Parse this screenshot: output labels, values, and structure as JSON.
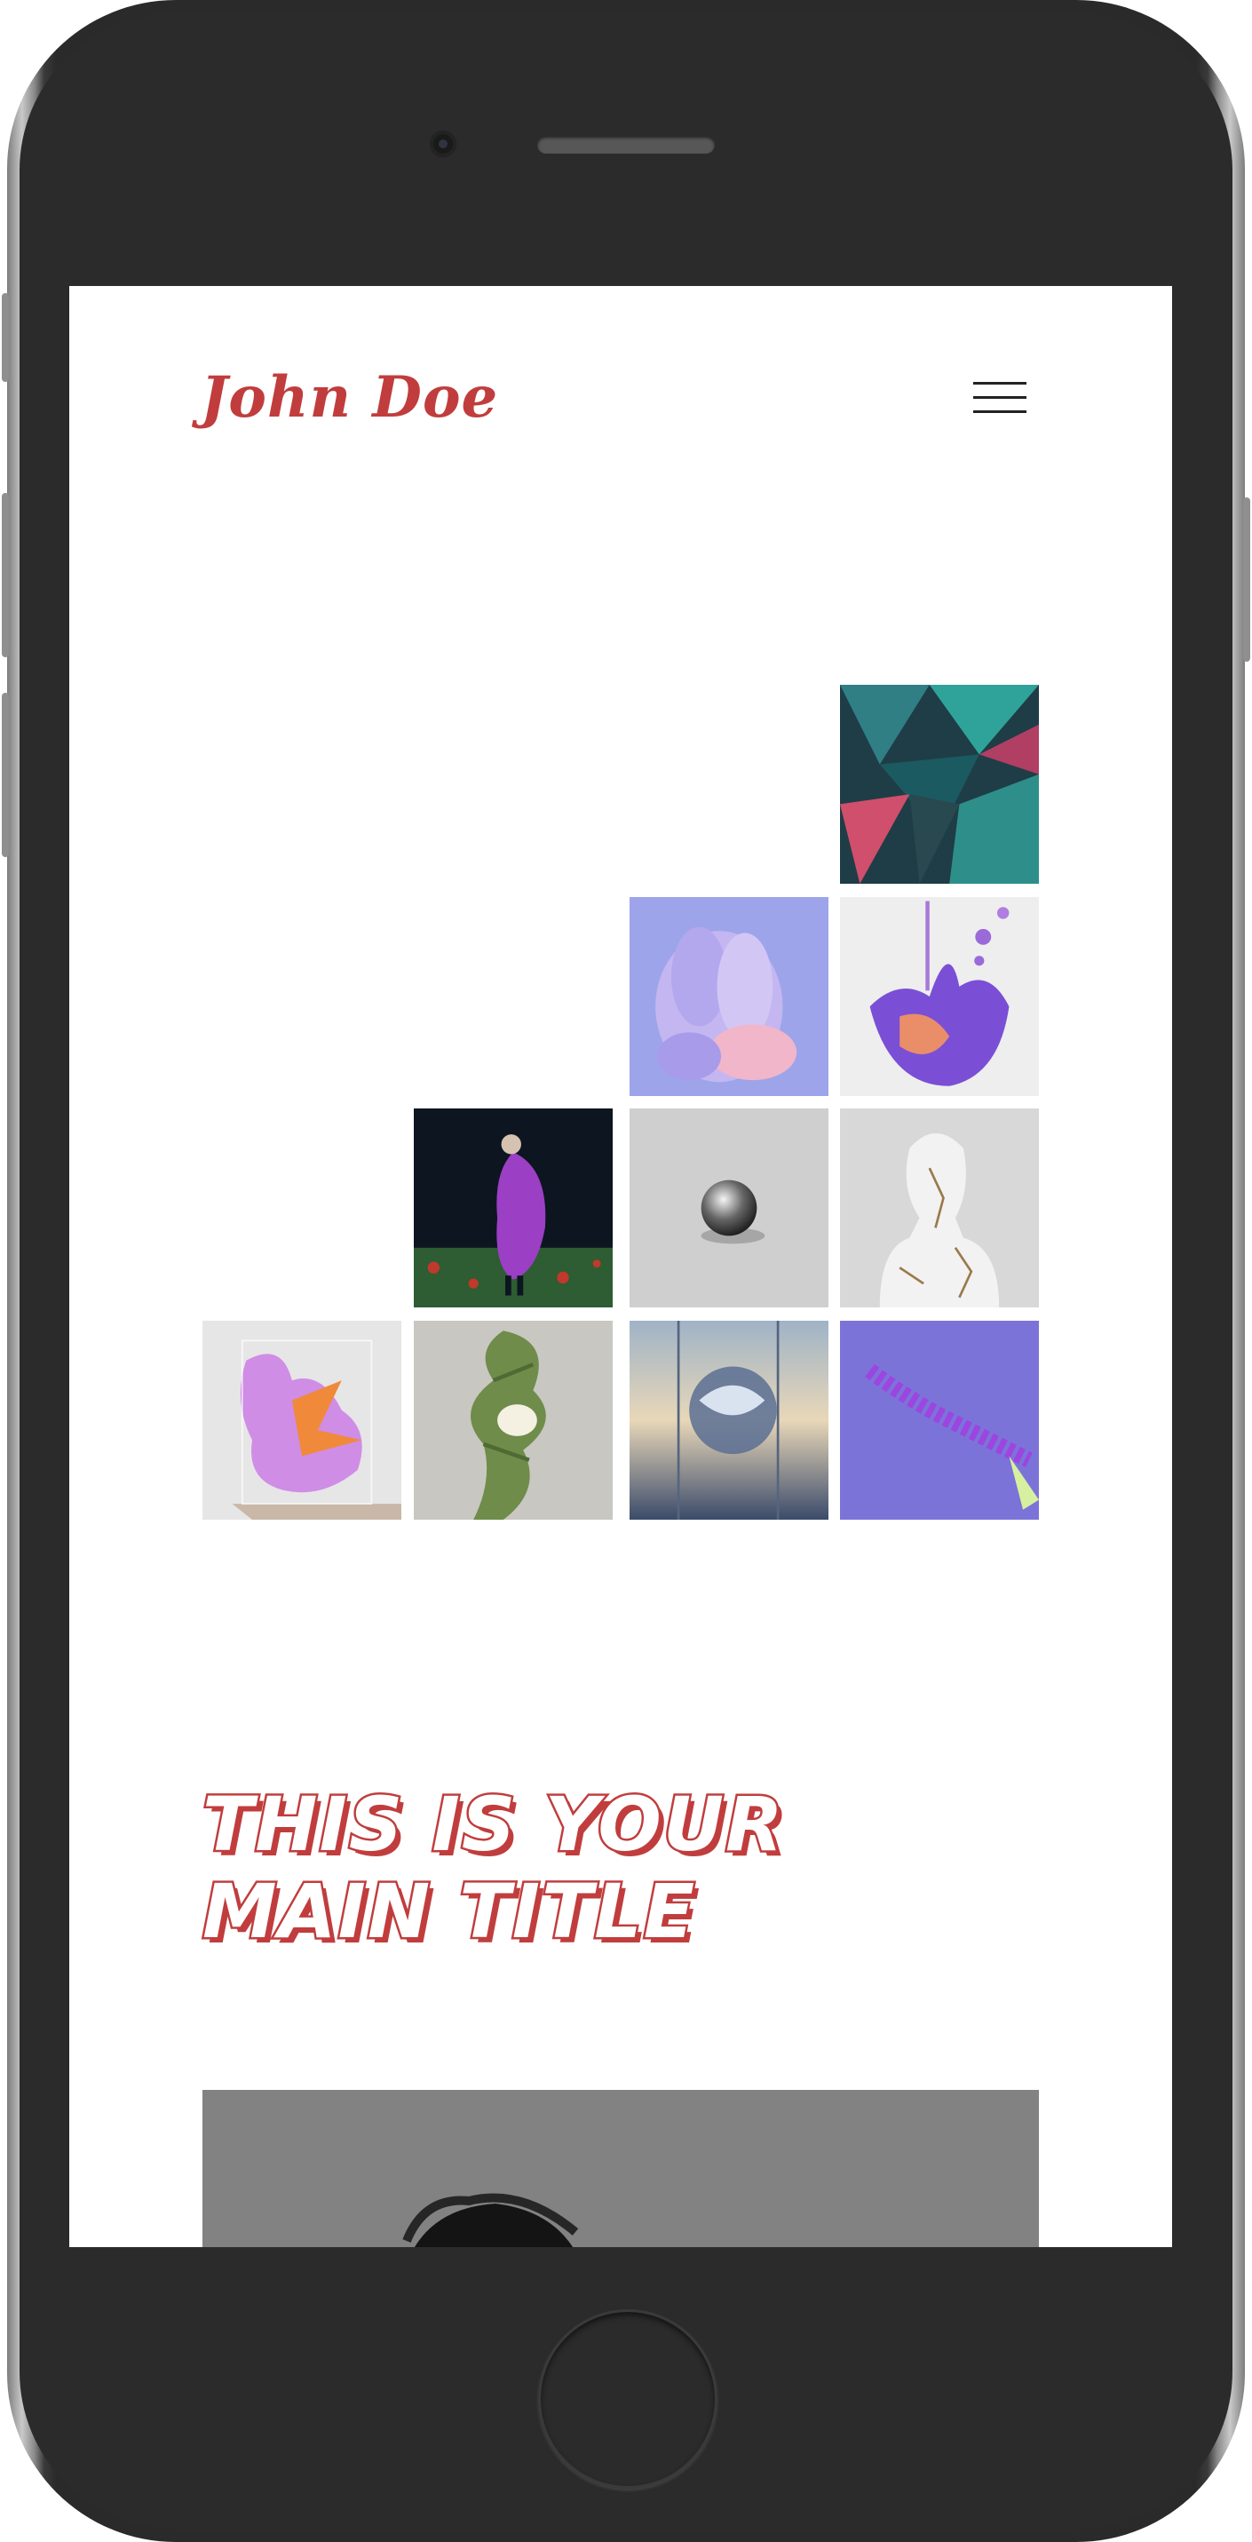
{
  "site": {
    "logo": "John Doe",
    "menu_icon": "hamburger-icon"
  },
  "gallery": {
    "items": [
      {
        "name": "teal-crystal-shards",
        "colors": [
          "#1f3d46",
          "#2fa39a",
          "#d04f6c"
        ]
      },
      {
        "name": "lavender-sculpture",
        "colors": [
          "#9da4ea",
          "#c4b6f1",
          "#f1b6c9"
        ]
      },
      {
        "name": "purple-liquid-splash",
        "colors": [
          "#eeeeee",
          "#7a4fd6",
          "#ea8e6a"
        ]
      },
      {
        "name": "figure-in-purple-coat",
        "colors": [
          "#0c1520",
          "#9b3fc4",
          "#2e5c33"
        ]
      },
      {
        "name": "chrome-sphere",
        "colors": [
          "#cfcfcf",
          "#555555",
          "#eaeaea"
        ]
      },
      {
        "name": "marble-bust",
        "colors": [
          "#d8d8d8",
          "#f2f2f2",
          "#9a7a4a"
        ]
      },
      {
        "name": "pink-glass-cube",
        "colors": [
          "#e6e6e6",
          "#cf8de6",
          "#f08a3a"
        ]
      },
      {
        "name": "leaf-figure",
        "colors": [
          "#c9c7c1",
          "#6f8c4a",
          "#f4f0e2"
        ]
      },
      {
        "name": "glass-orb-desert",
        "colors": [
          "#9fb3c7",
          "#3b4b6a",
          "#e8d7b8"
        ]
      },
      {
        "name": "violet-spiral-ribbon",
        "colors": [
          "#7c73d9",
          "#9c45e0",
          "#d7f0a0"
        ]
      }
    ]
  },
  "main_title": "THIS IS YOUR MAIN TITLE"
}
